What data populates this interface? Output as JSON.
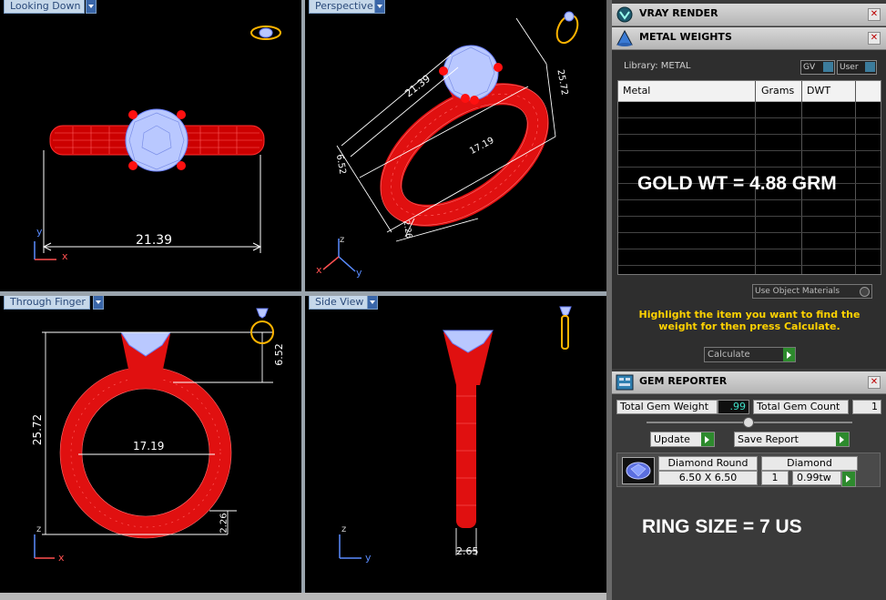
{
  "viewports": {
    "top_left": {
      "label": "Looking Down",
      "dim_width": "21.39",
      "axis_x": "x",
      "axis_y": "y"
    },
    "top_right": {
      "label": "Perspective",
      "dim_a": "21.39",
      "dim_b": "17.19",
      "dim_c": "6.52",
      "dim_d": "25.72",
      "dim_e": "2.26",
      "axis_x": "x",
      "axis_y": "y",
      "axis_z": "z"
    },
    "bottom_left": {
      "label": "Through Finger",
      "dim_height": "25.72",
      "dim_inner": "17.19",
      "dim_head": "6.52",
      "dim_band": "2.26",
      "axis_x": "x",
      "axis_z": "z"
    },
    "bottom_right": {
      "label": "Side View",
      "dim_width": "2.65",
      "axis_y": "y",
      "axis_z": "z"
    }
  },
  "panel": {
    "vray": {
      "title": "VRAY RENDER",
      "icon": "vray-sphere-icon"
    },
    "metal": {
      "title": "METAL WEIGHTS",
      "icon": "metal-cone-icon",
      "library_label": "Library: METAL",
      "gv_label": "GV",
      "user_label": "User",
      "columns": [
        "Metal",
        "Grams",
        "DWT"
      ],
      "use_object_materials": "Use Object Materials",
      "instruction": "Highlight the item you want to find the weight for then press Calculate.",
      "calculate_label": "Calculate"
    },
    "gem": {
      "title": "GEM REPORTER",
      "icon": "gem-report-icon",
      "total_weight_label": "Total Gem Weight",
      "total_weight_value": ".99",
      "total_count_label": "Total Gem Count",
      "total_count_value": "1",
      "update_label": "Update",
      "save_label": "Save Report",
      "row": {
        "shape": "Diamond Round",
        "size": "6.50 X 6.50",
        "material": "Diamond",
        "qty": "1",
        "carat": "0.99tw"
      }
    }
  },
  "overlay": {
    "gold_weight": "GOLD WT = 4.88 GRM",
    "ring_size": "RING SIZE = 7 US"
  },
  "colors": {
    "metal": "#e01010",
    "gem": "#b9c8ff",
    "dim_line": "#ffffff",
    "accent_green": "#2d8a2d",
    "instruction": "#ffd200"
  }
}
